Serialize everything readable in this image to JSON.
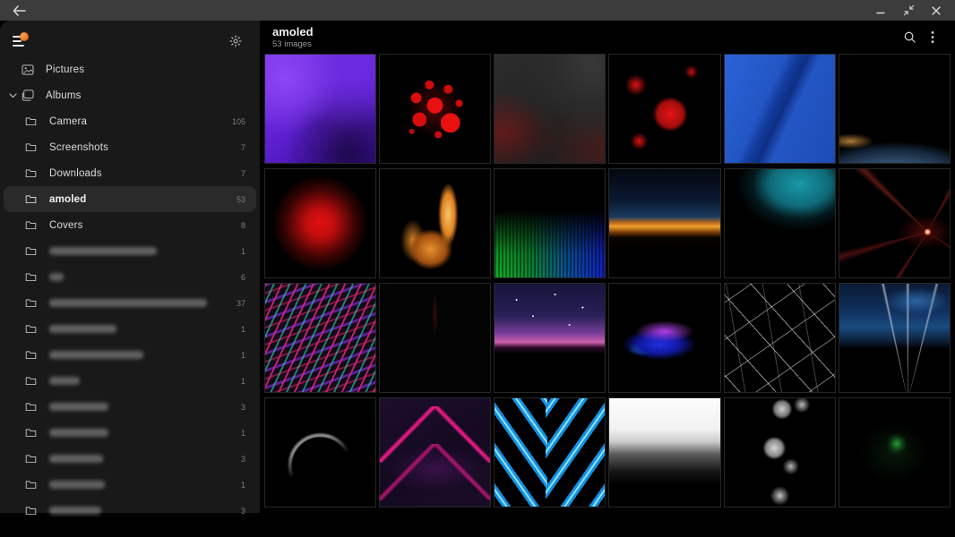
{
  "titlebar": {
    "back_icon": "arrow-left",
    "minimize_icon": "minimize",
    "restore_icon": "restore-down",
    "close_icon": "close"
  },
  "sidebar": {
    "logo": "gallery-app-logo",
    "settings_icon": "gear",
    "top_items": [
      {
        "label": "Pictures"
      },
      {
        "label": "Albums"
      }
    ],
    "albums": [
      {
        "label": "Camera",
        "count": "105"
      },
      {
        "label": "Screenshots",
        "count": "7"
      },
      {
        "label": "Downloads",
        "count": "7"
      },
      {
        "label": "amoled",
        "count": "53"
      },
      {
        "label": "Covers",
        "count": "8"
      },
      {
        "label": "",
        "count": "1"
      },
      {
        "label": "",
        "count": "6"
      },
      {
        "label": "",
        "count": "37"
      },
      {
        "label": "",
        "count": "1"
      },
      {
        "label": "",
        "count": "1"
      },
      {
        "label": "",
        "count": "1"
      },
      {
        "label": "",
        "count": "3"
      },
      {
        "label": "",
        "count": "1"
      },
      {
        "label": "",
        "count": "3"
      },
      {
        "label": "",
        "count": "1"
      },
      {
        "label": "",
        "count": "3"
      }
    ]
  },
  "header": {
    "title": "amoled",
    "subtitle": "53 images",
    "search_icon": "search",
    "menu_icon": "kebab-menu"
  },
  "grid": {
    "items": [
      {
        "name": "purple-petals-macro"
      },
      {
        "name": "red-dot-burst"
      },
      {
        "name": "dark-gray-swirl-red-accents"
      },
      {
        "name": "red-flowers-on-black"
      },
      {
        "name": "blue-feather-texture"
      },
      {
        "name": "earth-horizon-from-space"
      },
      {
        "name": "red-radial-flower"
      },
      {
        "name": "fire-flames"
      },
      {
        "name": "green-blue-audio-spectrum"
      },
      {
        "name": "sunset-horizon-band"
      },
      {
        "name": "teal-smoke"
      },
      {
        "name": "red-light-streak-burst"
      },
      {
        "name": "neon-contour-waves"
      },
      {
        "name": "near-black-faint-red"
      },
      {
        "name": "pink-starry-sky-mountains"
      },
      {
        "name": "blue-purple-glossy-wave"
      },
      {
        "name": "white-crack-web"
      },
      {
        "name": "blue-night-sky-mountain-road"
      },
      {
        "name": "crescent-moon"
      },
      {
        "name": "magenta-chevrons"
      },
      {
        "name": "blue-neon-chevrons"
      },
      {
        "name": "white-mist-mountains"
      },
      {
        "name": "grayscale-lilies"
      },
      {
        "name": "green-particle-burst"
      }
    ]
  },
  "colors": {
    "titlebar_bg": "#3c3c3c",
    "sidebar_bg": "#191919",
    "main_bg": "#000000",
    "selected_row_bg": "#2a2a2a",
    "logo_accent": "#e06a1e"
  }
}
